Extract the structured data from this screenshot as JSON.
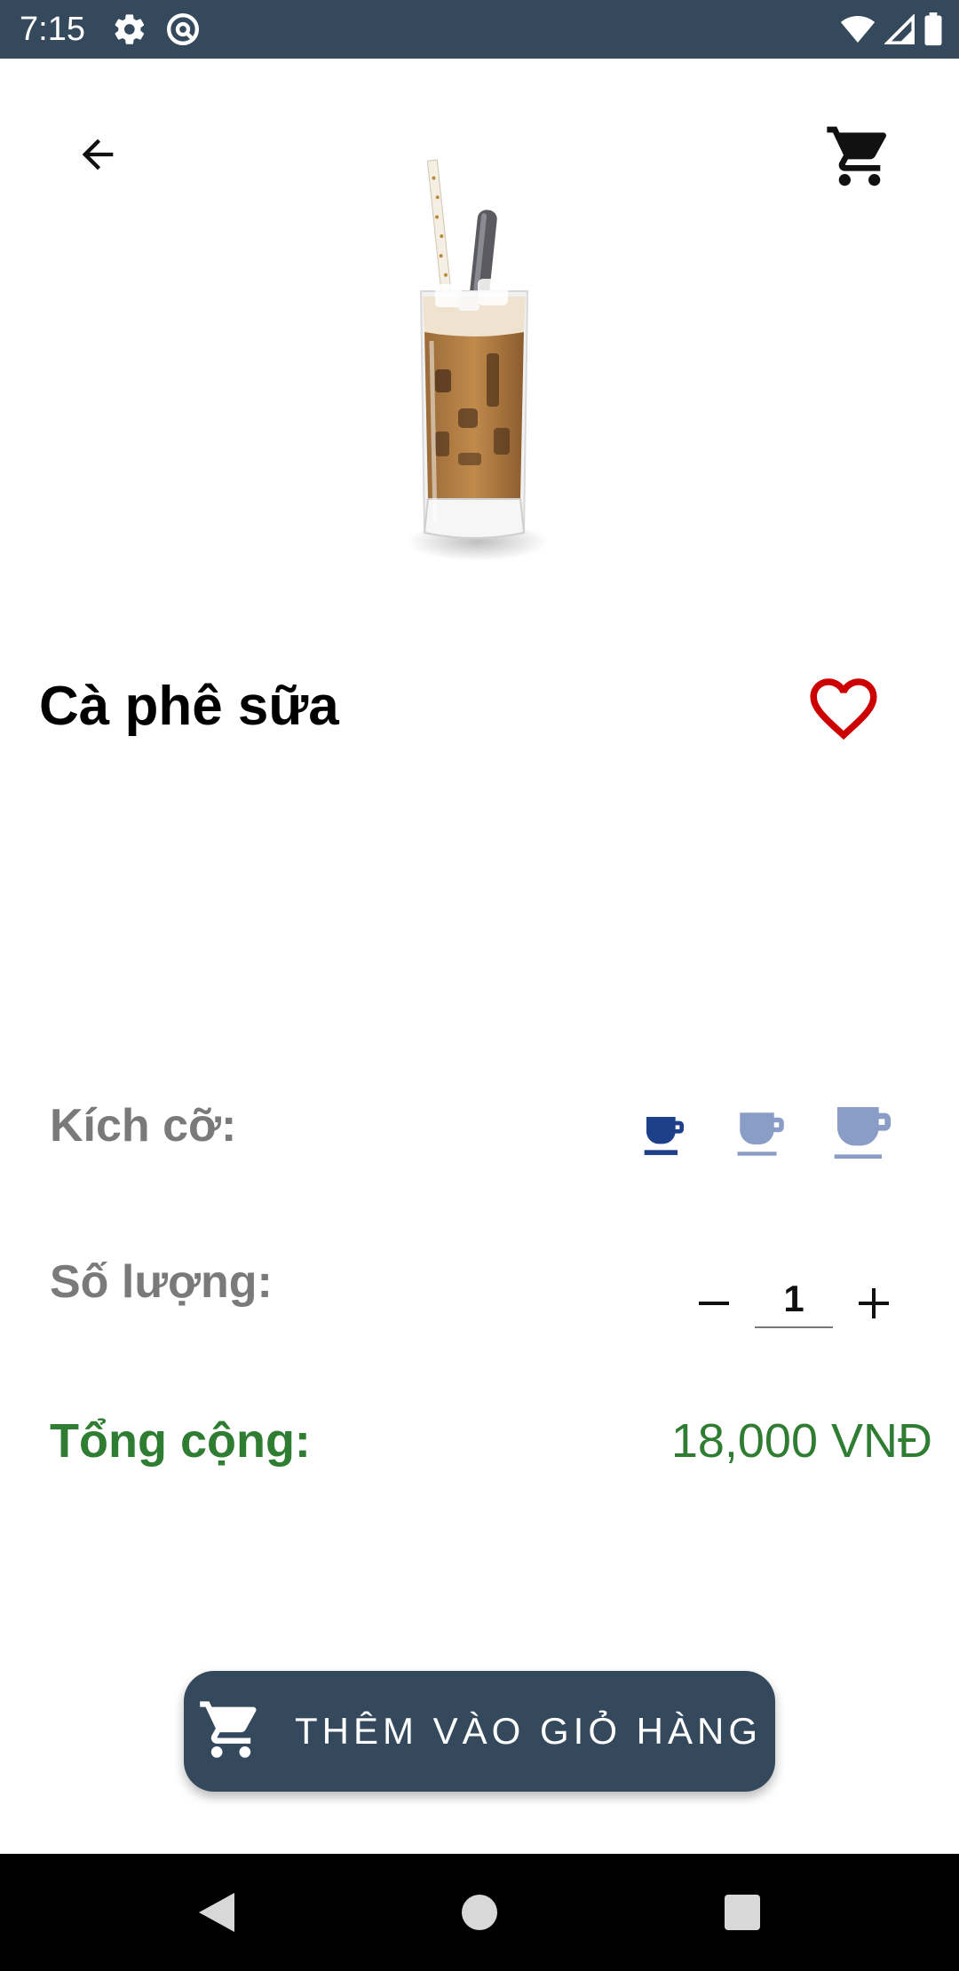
{
  "status_bar": {
    "time": "7:15",
    "left_icons": [
      "gear-icon",
      "at-sign-icon"
    ],
    "right_icons": [
      "wifi-icon",
      "signal-icon",
      "battery-icon"
    ]
  },
  "top_bar": {
    "back_icon": "arrow-left-icon",
    "cart_icon": "cart-icon"
  },
  "product": {
    "image": "iced-milk-coffee",
    "name": "Cà phê sữa",
    "favorite_icon": "heart-outline-icon"
  },
  "size": {
    "label": "Kích cỡ:",
    "options": [
      "small",
      "medium",
      "large"
    ],
    "selected": "small"
  },
  "quantity": {
    "label": "Số lượng:",
    "value": "1",
    "minus": "–",
    "plus": "+"
  },
  "total": {
    "label": "Tổng cộng:",
    "value": "18,000 VNĐ"
  },
  "add_to_cart": {
    "label": "THÊM VÀO GIỎ HÀNG",
    "icon": "cart-icon"
  },
  "colors": {
    "status_bar": "#35495c",
    "button": "#35495c",
    "total": "#2e7d32",
    "heart": "#cc0000",
    "cup_selected": "#1e3f8a",
    "cup_unselected": "#8a9dc7"
  },
  "nav_bar": {
    "icons": [
      "back-triangle-icon",
      "home-circle-icon",
      "recents-square-icon"
    ]
  }
}
